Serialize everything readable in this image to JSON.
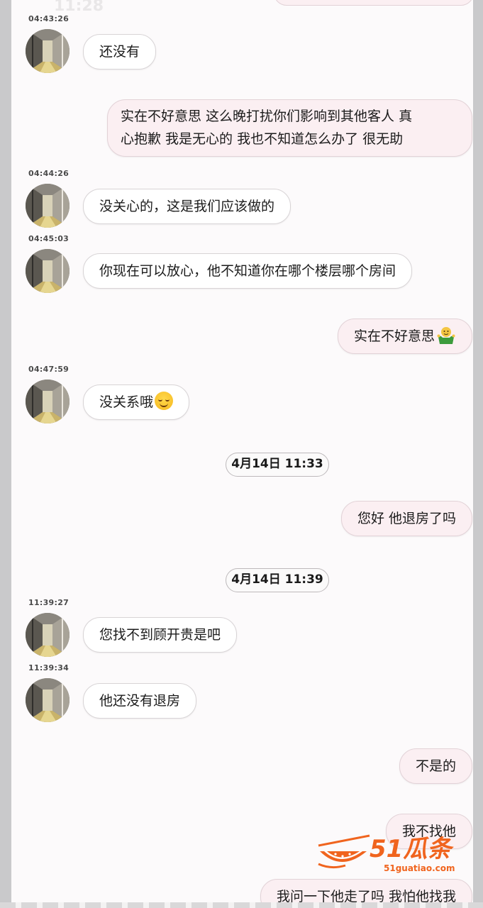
{
  "colors": {
    "incoming_bubble": "#ffffff",
    "outgoing_bubble": "#fbeff2",
    "background": "#fcfafb",
    "watermark_orange": "#f0641e"
  },
  "status_bar": {
    "time": "11:28"
  },
  "messages": [
    {
      "side": "in",
      "timestamp": "04:43:26",
      "text": "还没有"
    },
    {
      "side": "out",
      "line1": "实在不好意思 这么晚打扰你们影响到其他客人 真",
      "line2": "心抱歉 我是无心的 我也不知道怎么办了 很无助"
    },
    {
      "side": "in",
      "timestamp": "04:44:26",
      "text": "没关心的，这是我们应该做的"
    },
    {
      "side": "in",
      "timestamp": "04:45:03",
      "text": "你现在可以放心，他不知道你在哪个楼层哪个房间"
    },
    {
      "side": "out",
      "text": "实在不好意思",
      "emoji": "shrugging-person-emoji"
    },
    {
      "side": "in",
      "timestamp": "04:47:59",
      "text": "没关系哦",
      "emoji": "smiling-face-emoji"
    },
    {
      "type": "date",
      "text": "4月14日 11:33"
    },
    {
      "side": "out",
      "text": "您好 他退房了吗"
    },
    {
      "type": "date",
      "text": "4月14日 11:39"
    },
    {
      "side": "in",
      "timestamp": "11:39:27",
      "text": "您找不到顾开贵是吧"
    },
    {
      "side": "in",
      "timestamp": "11:39:34",
      "text": "他还没有退房"
    },
    {
      "side": "out",
      "text": "不是的"
    },
    {
      "side": "out",
      "text": "我不找他"
    },
    {
      "side": "out",
      "text": "我问一下他走了吗 我怕他找我"
    }
  ],
  "watermark": {
    "brand": "51瓜条",
    "url": "51guatiao.com"
  }
}
